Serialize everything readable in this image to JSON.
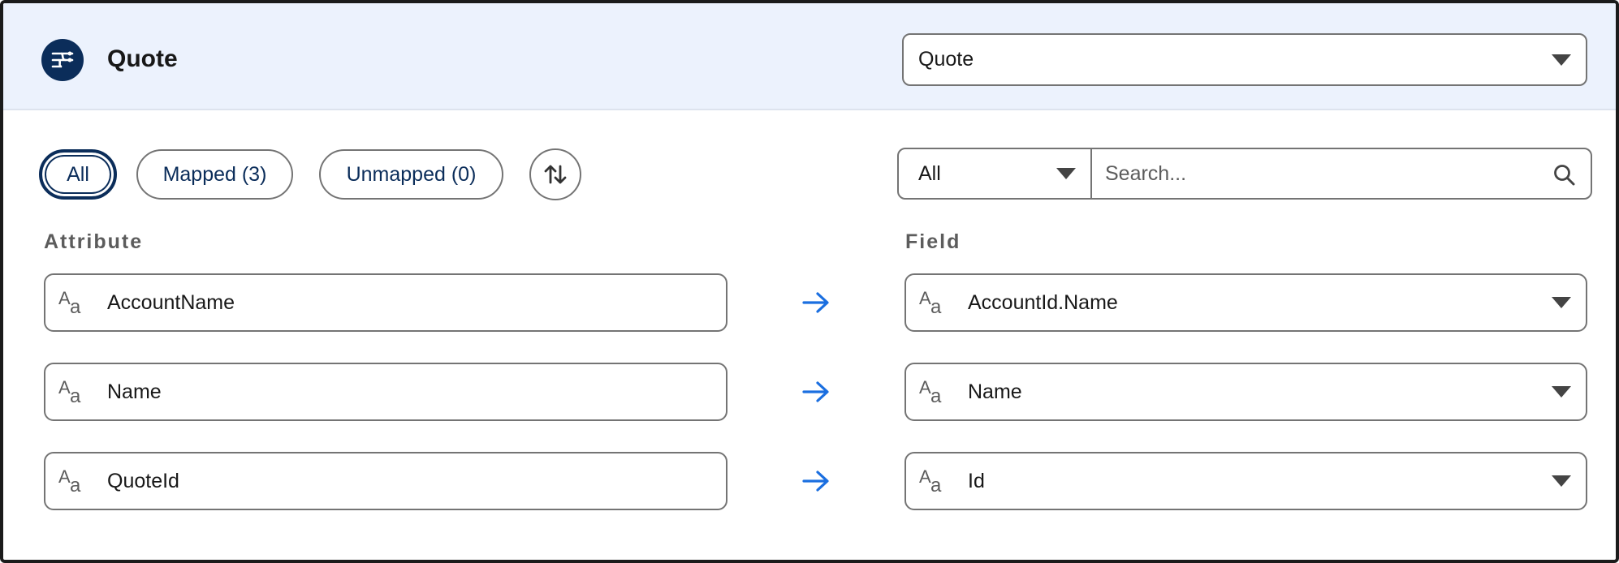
{
  "header": {
    "title": "Quote",
    "object_select_value": "Quote"
  },
  "filters": {
    "pills": [
      {
        "label": "All",
        "active": true
      },
      {
        "label": "Mapped (3)",
        "active": false
      },
      {
        "label": "Unmapped (0)",
        "active": false
      }
    ],
    "sort_icon": "sort-arrows-icon"
  },
  "search": {
    "scope_value": "All",
    "placeholder": "Search..."
  },
  "columns": {
    "attribute": "Attribute",
    "field": "Field"
  },
  "rows": [
    {
      "attribute": "AccountName",
      "field": "AccountId.Name"
    },
    {
      "attribute": "Name",
      "field": "Name"
    },
    {
      "attribute": "QuoteId",
      "field": "Id"
    }
  ],
  "colors": {
    "header_bg": "#ecf2fd",
    "brand_dark": "#0b2d5a",
    "arrow_blue": "#1b6fe0",
    "border_gray": "#747474"
  }
}
